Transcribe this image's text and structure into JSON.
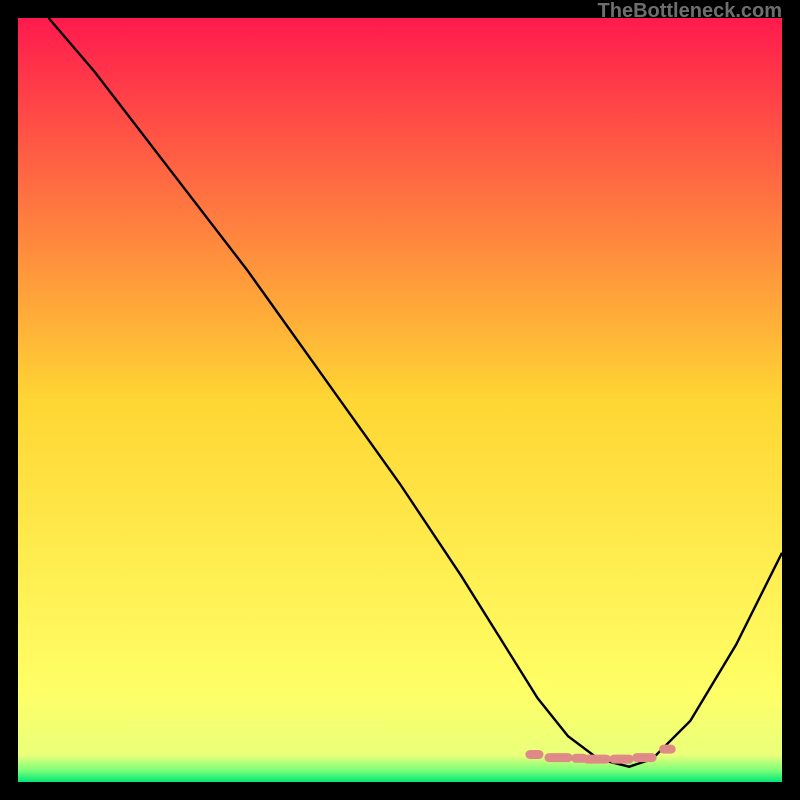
{
  "watermark": "TheBottleneck.com",
  "chart_data": {
    "type": "line",
    "title": "",
    "xlabel": "",
    "ylabel": "",
    "x_range": [
      0,
      100
    ],
    "y_range": [
      0,
      100
    ],
    "background_gradient": {
      "stops": [
        {
          "pos": 0.0,
          "color": "#ff1a4d"
        },
        {
          "pos": 0.5,
          "color": "#ffd633"
        },
        {
          "pos": 0.88,
          "color": "#ffff66"
        },
        {
          "pos": 0.965,
          "color": "#eaff7a"
        },
        {
          "pos": 0.985,
          "color": "#7aff7a"
        },
        {
          "pos": 1.0,
          "color": "#00e676"
        }
      ]
    },
    "series": [
      {
        "name": "bottleneck-curve",
        "x": [
          4,
          10,
          20,
          30,
          40,
          50,
          58,
          63,
          68,
          72,
          76,
          80,
          83,
          88,
          94,
          100
        ],
        "y": [
          100,
          93,
          80,
          67,
          53,
          39,
          27,
          19,
          11,
          6,
          3,
          2,
          3,
          8,
          18,
          30
        ]
      }
    ],
    "optimum_band": {
      "x_start": 67,
      "x_end": 85,
      "y": 3.2,
      "marker_color": "#e08a87",
      "segments": [
        {
          "x0": 67.0,
          "x1": 68.2,
          "y": 3.6
        },
        {
          "x0": 69.5,
          "x1": 72.0,
          "y": 3.2
        },
        {
          "x0": 73.0,
          "x1": 74.0,
          "y": 3.1
        },
        {
          "x0": 74.5,
          "x1": 77.0,
          "y": 3.0
        },
        {
          "x0": 78.0,
          "x1": 80.0,
          "y": 3.0
        },
        {
          "x0": 81.0,
          "x1": 83.0,
          "y": 3.2
        },
        {
          "x0": 84.5,
          "x1": 85.5,
          "y": 4.3
        }
      ]
    }
  }
}
